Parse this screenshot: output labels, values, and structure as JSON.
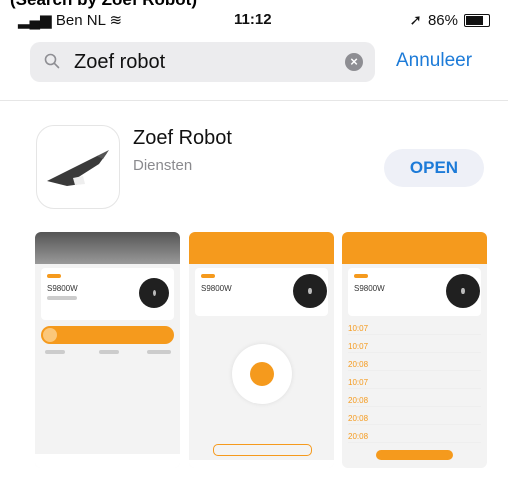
{
  "caption": "(Search by Zoef Robot)",
  "status_bar": {
    "carrier": "Ben NL",
    "time": "11:12",
    "battery_percent": "86%",
    "battery_level": 0.86
  },
  "search": {
    "query": "Zoef robot",
    "cancel_label": "Annuleer"
  },
  "app": {
    "name": "Zoef Robot",
    "category": "Diensten",
    "open_label": "OPEN"
  },
  "screenshots": {
    "shot1": {
      "model": "S9800W"
    },
    "shot2": {
      "model": "S9800W"
    },
    "shot3": {
      "model": "S9800W",
      "times": [
        "10:07",
        "10:07",
        "20:08",
        "10:07",
        "20:08",
        "20:08",
        "20:08"
      ]
    }
  },
  "colors": {
    "accent": "#1d7bd8",
    "brand_orange": "#f59a1d",
    "search_bg": "#ececee"
  }
}
